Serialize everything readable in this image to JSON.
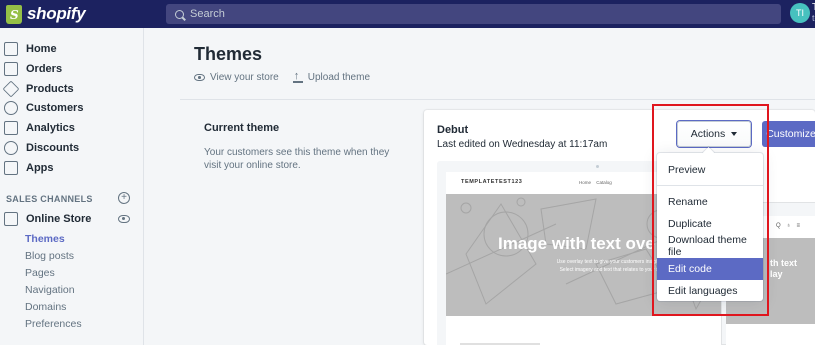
{
  "topbar": {
    "brand": "shopify",
    "search_placeholder": "Search",
    "avatar_initials": "TI",
    "user_initial": "Te",
    "user_sub": "te"
  },
  "sidebar": {
    "items": [
      {
        "label": "Home",
        "icon": "home-icon"
      },
      {
        "label": "Orders",
        "icon": "orders-icon"
      },
      {
        "label": "Products",
        "icon": "tag-icon"
      },
      {
        "label": "Customers",
        "icon": "person-icon"
      },
      {
        "label": "Analytics",
        "icon": "bar-chart-icon"
      },
      {
        "label": "Discounts",
        "icon": "discount-icon"
      },
      {
        "label": "Apps",
        "icon": "apps-icon"
      }
    ],
    "section_label": "SALES CHANNELS",
    "channel": "Online Store",
    "subitems": [
      "Themes",
      "Blog posts",
      "Pages",
      "Navigation",
      "Domains",
      "Preferences"
    ]
  },
  "main": {
    "title": "Themes",
    "view_store": "View your store",
    "upload_theme": "Upload theme",
    "current_theme_title": "Current theme",
    "current_theme_desc": "Your customers see this theme when they visit your online store.",
    "theme_name": "Debut",
    "theme_edited": "Last edited on Wednesday at 11:17am",
    "actions_label": "Actions",
    "customize_label": "Customize"
  },
  "preview": {
    "brand": "TEMPLATETEST123",
    "nav": "Home Catalog",
    "heading": "Image with text ove",
    "sub_line1": "Use overlay text to give your customers insight in",
    "sub_line2": "Select imagery and text that relates to your sty",
    "mobile_heading": "th text",
    "mobile_heading2": "lay",
    "mobile_icons": "Q ♁ ≡"
  },
  "dropdown": {
    "items": [
      "Preview",
      "Rename",
      "Duplicate",
      "Download theme file",
      "Edit code",
      "Edit languages"
    ],
    "active": "Edit code"
  },
  "colors": {
    "topbar": "#1c2260",
    "accent": "#5c6ac4",
    "annotation": "#e0161e"
  }
}
